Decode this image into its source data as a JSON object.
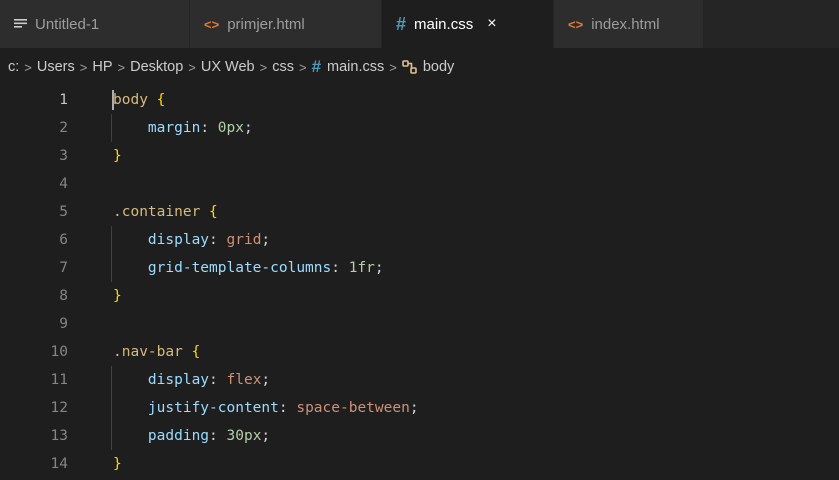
{
  "tabs": [
    {
      "label": "Untitled-1",
      "icon": "lines-icon"
    },
    {
      "label": "primjer.html",
      "icon": "html-icon"
    },
    {
      "label": "main.css",
      "icon": "hash-icon",
      "active": true,
      "close": "×"
    },
    {
      "label": "index.html",
      "icon": "html-icon"
    }
  ],
  "breadcrumb": {
    "items": [
      "c:",
      "Users",
      "HP",
      "Desktop",
      "UX Web",
      "css",
      "main.css",
      "body"
    ],
    "separator": ">"
  },
  "editor": {
    "lines": [
      {
        "n": "1",
        "text": "body {"
      },
      {
        "n": "2",
        "text": "margin: 0px;"
      },
      {
        "n": "3",
        "text": "}"
      },
      {
        "n": "4",
        "text": ""
      },
      {
        "n": "5",
        "text": ".container {"
      },
      {
        "n": "6",
        "text": "display: grid;"
      },
      {
        "n": "7",
        "text": "grid-template-columns: 1fr;"
      },
      {
        "n": "8",
        "text": "}"
      },
      {
        "n": "9",
        "text": ""
      },
      {
        "n": "10",
        "text": ".nav-bar {"
      },
      {
        "n": "11",
        "text": "display: flex;"
      },
      {
        "n": "12",
        "text": "justify-content: space-between;"
      },
      {
        "n": "13",
        "text": "padding: 30px;"
      },
      {
        "n": "14",
        "text": "}"
      }
    ]
  },
  "colors": {
    "selector": "#d7ba7d",
    "property": "#9cdcfe",
    "value": "#ce9178",
    "number": "#b5cea8",
    "brace": "#ffd700",
    "css_icon": "#519aba",
    "html_icon": "#e37933"
  }
}
